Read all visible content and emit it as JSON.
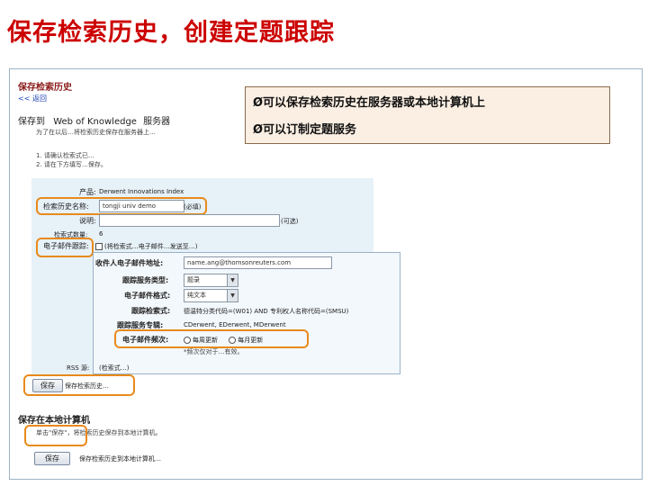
{
  "slide_title": "保存检索历史，创建定题跟踪",
  "callout": {
    "line1": "Ø可以保存检索历史在服务器或本地计算机上",
    "line2": "Ø可以订制定题服务"
  },
  "panel": {
    "header": "保存检索历史",
    "back_link": "<< 返回",
    "server_title_pre": "保存到",
    "server_title_wok": "Web of Knowledge",
    "server_title_post": "服务器",
    "server_desc": "为了在以后…将检索历史保存在服务器上…",
    "step1": "1. 请确认检索式已…",
    "step2": "2. 请在下方填写…保存。",
    "form": {
      "product_label": "产品:",
      "product_value": "Derwent Innovations Index",
      "history_name_label": "检索历史名称:",
      "history_name_value": "tongji univ demo",
      "history_name_hint": "(必填)",
      "desc_label": "说明:",
      "desc_hint": "(可选)",
      "query_count_label": "检索式数量:",
      "query_count_value": "6",
      "alert_label": "电子邮件跟踪:",
      "alert_text": "(将检索式…电子邮件…发送至…)",
      "recipient_label": "收件人电子邮件地址:",
      "recipient_value": "name.ang@thomsonreuters.com",
      "tracking_type_label": "跟踪服务类型:",
      "tracking_type_value": "题录",
      "email_format_label": "电子邮件格式:",
      "email_format_value": "纯文本",
      "tracking_query_label": "跟踪检索式:",
      "tracking_query_value": "德温特分类代码=(W01) AND 专利权人名称代码=(SMSU)",
      "tracking_db_label": "跟踪服务专辑:",
      "tracking_db_value": "CDerwent, EDerwent, MDerwent",
      "frequency_label": "电子邮件频次:",
      "freq_opt1": "每周更新",
      "freq_opt2": "每月更新",
      "frequency_note": "*频次仅对于…有效。",
      "rss_label": "RSS 源:",
      "rss_text": "(检索式…)",
      "save_button": "保存",
      "save_note": "保存检索历史…"
    },
    "local_title": "保存在本地计算机",
    "local_desc": "单击\"保存\"，将检索历史保存到本地计算机。",
    "browse_button": "保存",
    "browse_note": "保存检索历史到本地计算机…"
  },
  "colors": {
    "title_red": "#cc0000",
    "highlight_orange": "#e88a1c",
    "panel_border": "#9ab3c7",
    "form_bg": "#e7f1f8"
  }
}
